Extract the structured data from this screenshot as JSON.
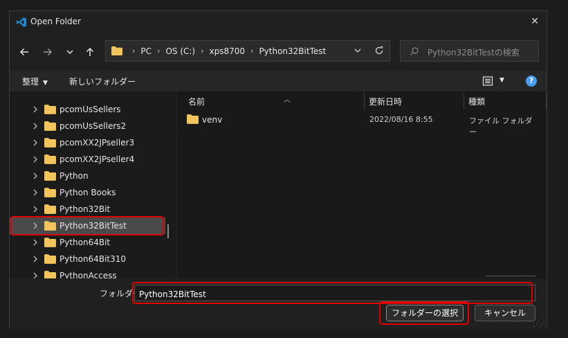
{
  "window": {
    "title": "Open Folder",
    "close": "✕"
  },
  "nav": {
    "back": "back",
    "forward": "forward",
    "recent": "recent",
    "up": "up"
  },
  "breadcrumb": [
    "PC",
    "OS (C:)",
    "xps8700",
    "Python32BitTest"
  ],
  "search": {
    "placeholder": "Python32BitTestの検索"
  },
  "toolbar": {
    "organize": "整理",
    "new_folder": "新しいフォルダー",
    "help": "?"
  },
  "tree": {
    "items": [
      {
        "label": "pcomUsSellers"
      },
      {
        "label": "pcomUsSellers2"
      },
      {
        "label": "pcomXX2JPseller3"
      },
      {
        "label": "pcomXX2JPseller4"
      },
      {
        "label": "Python"
      },
      {
        "label": "Python Books"
      },
      {
        "label": "Python32Bit"
      },
      {
        "label": "Python32BitTest",
        "selected": true
      },
      {
        "label": "Python64Bit"
      },
      {
        "label": "Python64Bit310"
      },
      {
        "label": "PythonAccess"
      }
    ]
  },
  "columns": {
    "name": "名前",
    "date": "更新日時",
    "type": "種類"
  },
  "files": [
    {
      "name": "venv",
      "date": "2022/08/16 8:55",
      "type": "ファイル フォルダー"
    }
  ],
  "footer": {
    "folder_label": "フォルダー:",
    "folder_value": "Python32BitTest",
    "select_button": "フォルダーの選択",
    "cancel_button": "キャンセル"
  },
  "colors": {
    "accent": "#4a9cf0",
    "highlight": "#e00000",
    "folder": "#f2c55c"
  }
}
